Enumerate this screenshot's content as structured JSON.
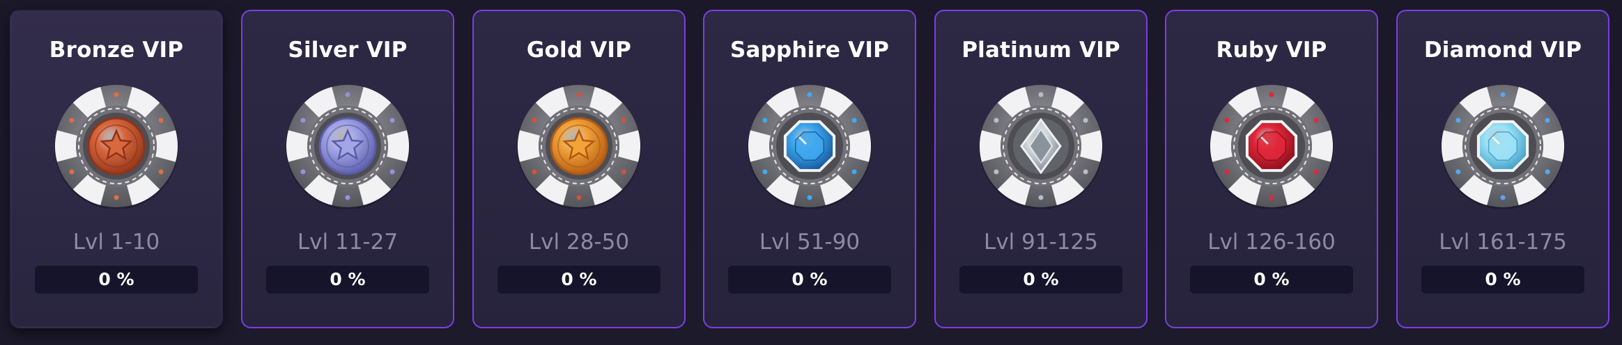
{
  "tiers": [
    {
      "name": "Bronze VIP",
      "levels": "Lvl 1-10",
      "progress_text": "0 %",
      "progress": 0,
      "icon": "bronze-star-chip-icon",
      "gem_color": "#d9683f",
      "gem_dark": "#8f3419",
      "accent": "#e06e45"
    },
    {
      "name": "Silver VIP",
      "levels": "Lvl 11-27",
      "progress_text": "0 %",
      "progress": 0,
      "icon": "silver-star-chip-icon",
      "gem_color": "#a3a6e6",
      "gem_dark": "#5a5ca8",
      "accent": "#9a8fe0"
    },
    {
      "name": "Gold VIP",
      "levels": "Lvl 28-50",
      "progress_text": "0 %",
      "progress": 0,
      "icon": "gold-star-chip-icon",
      "gem_color": "#f2a33a",
      "gem_dark": "#b25a12",
      "accent": "#d8503a"
    },
    {
      "name": "Sapphire VIP",
      "levels": "Lvl 51-90",
      "progress_text": "0 %",
      "progress": 0,
      "icon": "sapphire-gem-chip-icon",
      "gem_color": "#3fa9ef",
      "gem_dark": "#14579c",
      "accent": "#3fa9ef"
    },
    {
      "name": "Platinum VIP",
      "levels": "Lvl 91-125",
      "progress_text": "0 %",
      "progress": 0,
      "icon": "platinum-diamond-chip-icon",
      "gem_color": "#d7dbe0",
      "gem_dark": "#7c8590",
      "accent": "#b8bec6"
    },
    {
      "name": "Ruby VIP",
      "levels": "Lvl 126-160",
      "progress_text": "0 %",
      "progress": 0,
      "icon": "ruby-gem-chip-icon",
      "gem_color": "#e0283a",
      "gem_dark": "#8a0e1a",
      "accent": "#e0283a"
    },
    {
      "name": "Diamond VIP",
      "levels": "Lvl 161-175",
      "progress_text": "0 %",
      "progress": 0,
      "icon": "diamond-gem-chip-icon",
      "gem_color": "#9fe3f7",
      "gem_dark": "#3f9fc7",
      "accent": "#5aa6f2"
    }
  ],
  "colors": {
    "card_border": "#7b3fe0",
    "progress_track": "#16142a",
    "level_text": "#8d8aa3"
  }
}
